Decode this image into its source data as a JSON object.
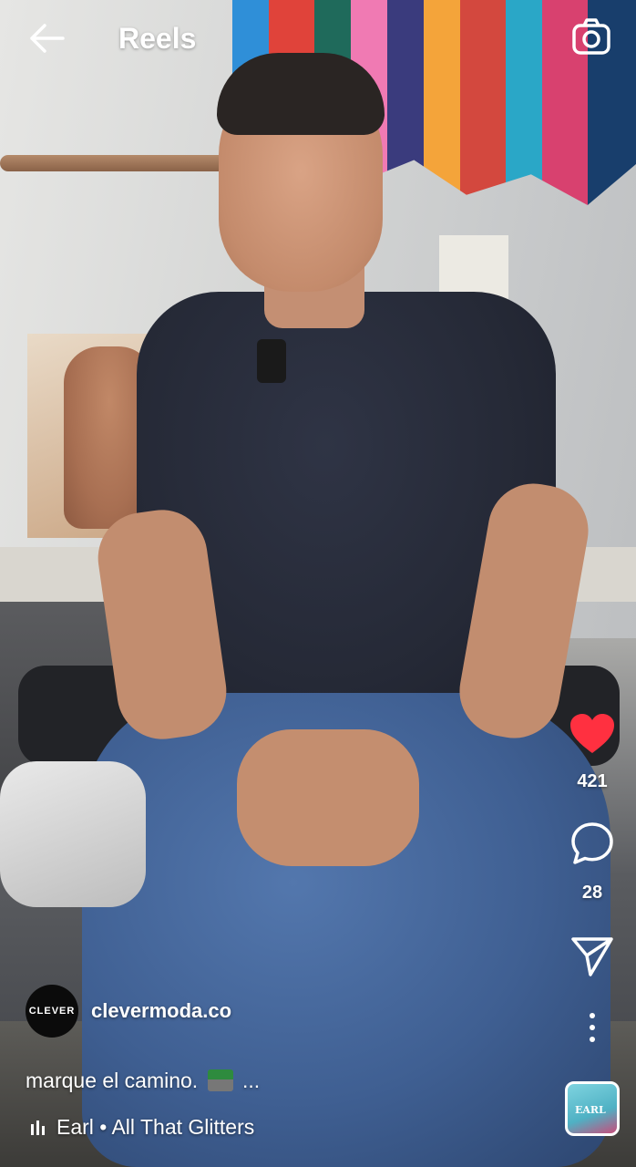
{
  "topbar": {
    "title": "Reels",
    "back_icon": "arrow-left-icon",
    "camera_icon": "camera-icon"
  },
  "actions": {
    "like": {
      "icon": "heart-filled-icon",
      "count": "421",
      "color": "#ff3040"
    },
    "comment": {
      "icon": "comment-bubble-icon",
      "count": "28"
    },
    "share": {
      "icon": "paper-plane-icon"
    },
    "more": {
      "icon": "more-vertical-icon"
    }
  },
  "author": {
    "avatar_text": "CLEVER",
    "username": "clevermoda.co"
  },
  "caption": {
    "text": "marque el camino.",
    "more": "..."
  },
  "music": {
    "text": "Earl • All That Glitters",
    "icon": "audio-bars-icon",
    "thumb_text": "EARL"
  }
}
